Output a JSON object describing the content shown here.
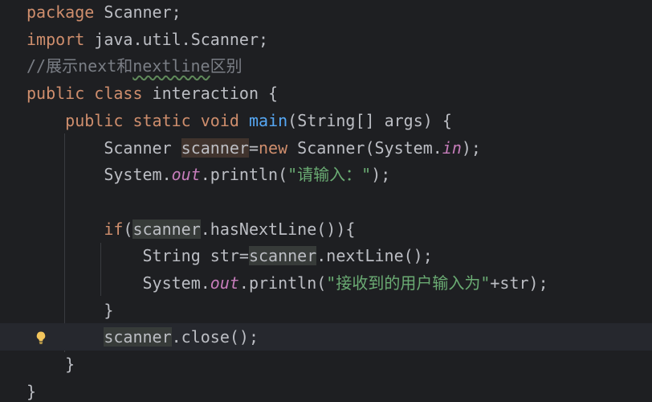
{
  "lines": [
    [
      {
        "t": "package",
        "c": "kw"
      },
      {
        "t": " Scanner;"
      }
    ],
    [
      {
        "t": "import",
        "c": "kw"
      },
      {
        "t": " java.util.Scanner;"
      }
    ],
    [
      {
        "t": "//展示next和",
        "c": "cm"
      },
      {
        "t": "nextline",
        "c": "cm typo"
      },
      {
        "t": "区别",
        "c": "cm"
      }
    ],
    [
      {
        "t": "public",
        "c": "kw"
      },
      {
        "t": " "
      },
      {
        "t": "class",
        "c": "kw"
      },
      {
        "t": " interaction {"
      }
    ],
    [
      {
        "t": "    "
      },
      {
        "t": "public",
        "c": "kw"
      },
      {
        "t": " "
      },
      {
        "t": "static",
        "c": "kw"
      },
      {
        "t": " "
      },
      {
        "t": "void",
        "c": "kw"
      },
      {
        "t": " "
      },
      {
        "t": "main",
        "c": "fn"
      },
      {
        "t": "(String[] args) {"
      }
    ],
    [
      {
        "t": "        Scanner "
      },
      {
        "t": "scanner",
        "c": "hl-write"
      },
      {
        "t": "="
      },
      {
        "t": "new",
        "c": "kw"
      },
      {
        "t": " Scanner(System."
      },
      {
        "t": "in",
        "c": "st"
      },
      {
        "t": ");"
      }
    ],
    [
      {
        "t": "        System."
      },
      {
        "t": "out",
        "c": "st"
      },
      {
        "t": ".println("
      },
      {
        "t": "\"请输入：\"",
        "c": "str"
      },
      {
        "t": ");"
      }
    ],
    [
      {
        "t": ""
      }
    ],
    [
      {
        "t": "        "
      },
      {
        "t": "if",
        "c": "kw"
      },
      {
        "t": "("
      },
      {
        "t": "scanner",
        "c": "hl-read"
      },
      {
        "t": ".hasNextLine()){"
      }
    ],
    [
      {
        "t": "            String str="
      },
      {
        "t": "scanner",
        "c": "hl-read"
      },
      {
        "t": ".nextLine();"
      }
    ],
    [
      {
        "t": "            System."
      },
      {
        "t": "out",
        "c": "st"
      },
      {
        "t": ".println("
      },
      {
        "t": "\"接收到的用户输入为\"",
        "c": "str"
      },
      {
        "t": "+str);"
      }
    ],
    [
      {
        "t": "        }"
      }
    ],
    [
      {
        "t": "        "
      },
      {
        "t": "scanner",
        "c": "hl-read"
      },
      {
        "t": ".close();"
      }
    ],
    [
      {
        "t": "    }"
      }
    ],
    [
      {
        "t": "}"
      }
    ]
  ],
  "current_line_index": 12,
  "icons": {
    "intention": "lightbulb-icon"
  },
  "colors": {
    "background": "#1e1f22",
    "keyword": "#cf8e6d",
    "function": "#56a8f5",
    "string": "#6aab73",
    "static_field": "#c77dbb",
    "comment": "#7a7e85",
    "text": "#bcbec4"
  }
}
